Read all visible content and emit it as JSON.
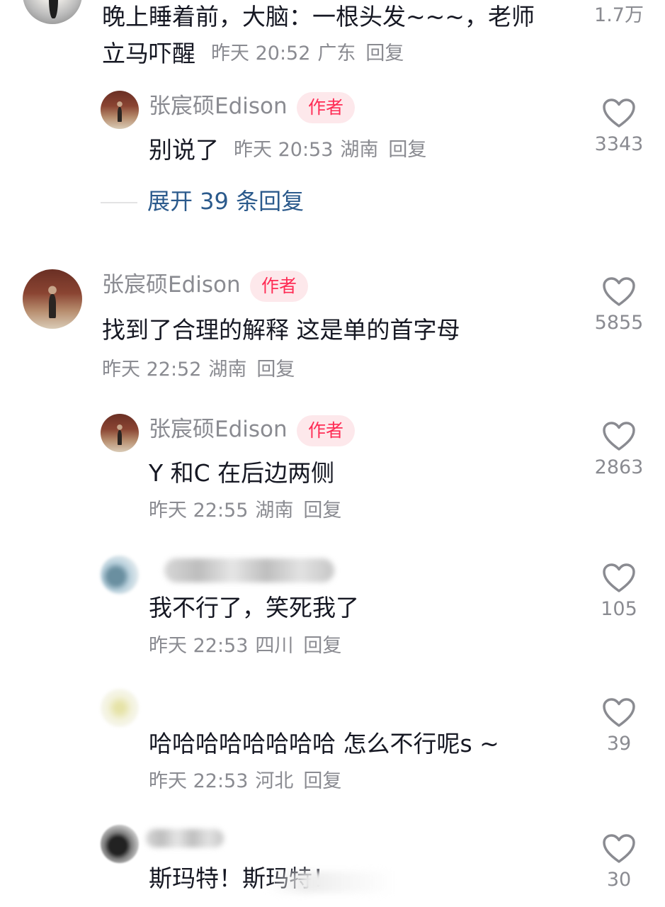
{
  "comment0": {
    "text_line1": "晚上睡着前，大脑：一根头发~~~，老师",
    "text_line2": "立马吓醒",
    "time": "昨天 20:52",
    "location": "广东",
    "reply_label": "回复",
    "likes": "1.7万"
  },
  "reply0a": {
    "name": "张宸硕Edison",
    "badge": "作者",
    "text": "别说了",
    "time": "昨天 20:53",
    "location": "湖南",
    "reply_label": "回复",
    "likes": "3343"
  },
  "expand": {
    "label": "展开 39 条回复"
  },
  "comment1": {
    "name": "张宸硕Edison",
    "badge": "作者",
    "text": "找到了合理的解释 这是单的首字母",
    "time": "昨天 22:52",
    "location": "湖南",
    "reply_label": "回复",
    "likes": "5855"
  },
  "reply1a": {
    "name": "张宸硕Edison",
    "badge": "作者",
    "text": "Y 和C 在后边两侧",
    "time": "昨天 22:55",
    "location": "湖南",
    "reply_label": "回复",
    "likes": "2863"
  },
  "reply1b": {
    "text": "我不行了，笑死我了",
    "time": "昨天 22:53",
    "location": "四川",
    "reply_label": "回复",
    "likes": "105"
  },
  "reply1c": {
    "text": "哈哈哈哈哈哈哈哈 怎么不行呢s ~",
    "time": "昨天 22:53",
    "location": "河北",
    "reply_label": "回复",
    "likes": "39"
  },
  "reply1d": {
    "text": "斯玛特！斯玛特！",
    "likes": "30"
  },
  "icons": {
    "like": "heart-outline-icon"
  },
  "colors": {
    "author_badge_bg": "#fde8eb",
    "author_badge_text": "#fe2c55",
    "expand_text": "#2b5a8c",
    "meta_text": "#8a8b91",
    "main_text": "#161823"
  }
}
